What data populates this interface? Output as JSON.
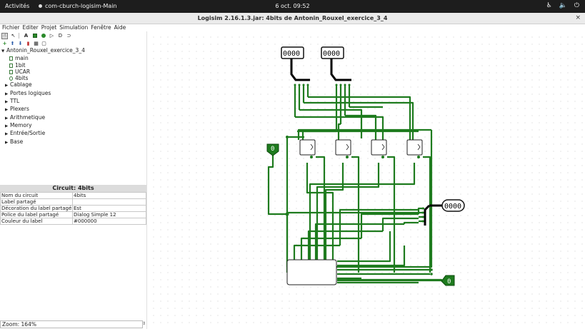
{
  "topbar": {
    "activities": "Activités",
    "app_name": "com-cburch-logisim-Main",
    "clock": "6 oct.  09:52"
  },
  "window": {
    "title": "Logisim 2.16.1.3.jar: 4bits de Antonin_Rouxel_exercice_3_4",
    "close": "×"
  },
  "menu": [
    "Fichier",
    "Editer",
    "Projet",
    "Simulation",
    "Fenêtre",
    "Aide"
  ],
  "explorer": {
    "project": "Antonin_Rouxel_exercice_3_4",
    "circuits": [
      "main",
      "1bit",
      "UCAR",
      "4bits"
    ],
    "libraries": [
      "Cablage",
      "Portes logiques",
      "TTL",
      "Plexers",
      "Arithmetique",
      "Memory",
      "Entrée/Sortie",
      "Base"
    ]
  },
  "properties": {
    "title": "Circuit: 4bits",
    "rows": [
      {
        "key": "Nom du circuit",
        "value": "4bits"
      },
      {
        "key": "Label partagé",
        "value": ""
      },
      {
        "key": "Décoration du label partagé",
        "value": "Est"
      },
      {
        "key": "Police du label partagé",
        "value": "Dialog Simple 12"
      },
      {
        "key": "Couleur du label",
        "value": "#000000"
      }
    ]
  },
  "zoom": "Zoom: 164%",
  "circuit": {
    "input_a": "0000",
    "input_b": "0000",
    "output_s": "0000",
    "carry_in": "0",
    "carry_out": "0",
    "wire_color": "#1e7b1e",
    "bus_color": "#000000"
  }
}
